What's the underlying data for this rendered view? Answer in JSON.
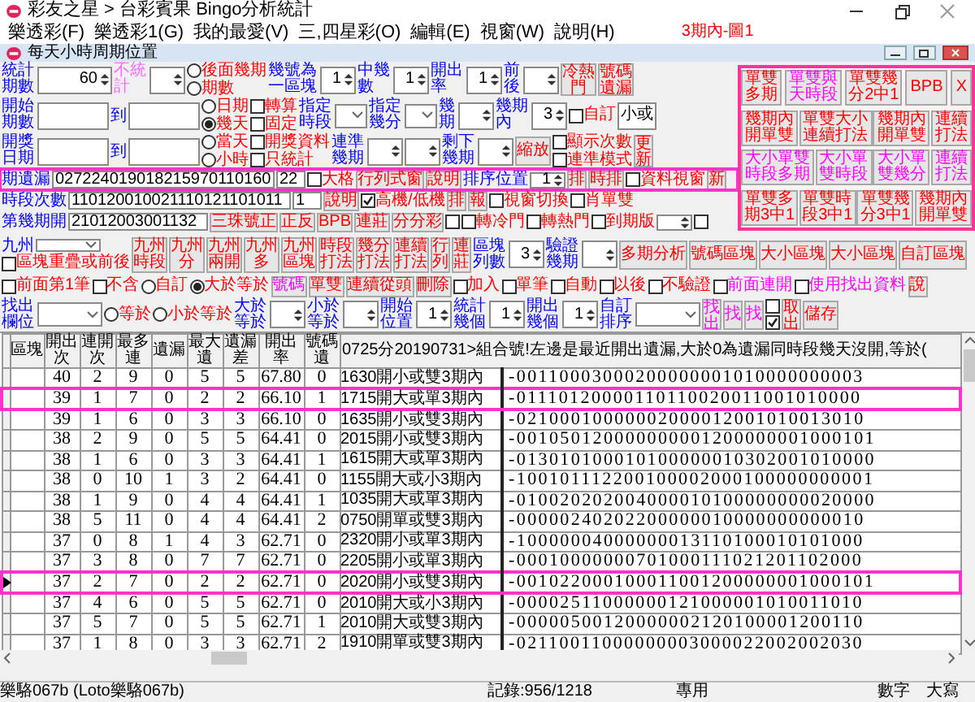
{
  "window": {
    "title": "彩友之星 > 台彩賓果 Bingo分析統計"
  },
  "menu": [
    "樂透彩(F)",
    "樂透彩1(G)",
    "我的最愛(V)",
    "三,四星彩(O)",
    "編輯(E)",
    "視窗(W)",
    "說明(H)"
  ],
  "caption": "3期內-圖1",
  "child_window": {
    "title": "每天小時周期位置"
  },
  "top_rows": [
    {
      "highlighted": false,
      "items": [
        {
          "kind": "label2",
          "text": "統計期數",
          "color": "#0000ff"
        },
        {
          "kind": "wide_spinner",
          "value": "60"
        },
        {
          "kind": "label2",
          "text": "不統計",
          "color": "#ff66ff"
        },
        {
          "kind": "spinner"
        },
        {
          "kind": "stack",
          "rows": [
            [
              {
                "kind": "radio",
                "text": "後面幾期",
                "color": "#ff0000",
                "selected": false
              }
            ],
            [
              {
                "kind": "radio",
                "text": "期數",
                "color": "#ff0000",
                "selected": false
              }
            ]
          ]
        },
        {
          "kind": "label2",
          "text": "幾號為一區塊",
          "color": "#0000ff"
        },
        {
          "kind": "spinner",
          "value": "1"
        },
        {
          "kind": "label2",
          "text": "中幾數",
          "color": "#0000ff"
        },
        {
          "kind": "spinner",
          "value": "1"
        },
        {
          "kind": "label2",
          "text": "開出率",
          "color": "#0000ff"
        },
        {
          "kind": "spinner",
          "value": "1"
        },
        {
          "kind": "label2",
          "text": "前後",
          "color": "#0000ff"
        },
        {
          "kind": "spinner"
        },
        {
          "kind": "button2",
          "text": "冷熱門",
          "color": "#ff0000"
        },
        {
          "kind": "button2",
          "text": "號碼遺漏",
          "color": "#ff0000"
        }
      ]
    },
    {
      "highlighted": false,
      "items": [
        {
          "kind": "label2",
          "text": "開始期數",
          "color": "#0000ff"
        },
        {
          "kind": "wide_field"
        },
        {
          "kind": "label",
          "text": "到",
          "color": "#0000ff"
        },
        {
          "kind": "wide_field"
        },
        {
          "kind": "stack",
          "rows": [
            [
              {
                "kind": "radio",
                "text": "日期",
                "color": "#ff0000",
                "selected": false
              },
              {
                "kind": "checkbox",
                "text": "轉算",
                "color": "#ff0000",
                "checked": false
              }
            ],
            [
              {
                "kind": "radio",
                "text": "幾天",
                "color": "#ff0000",
                "selected": true
              },
              {
                "kind": "checkbox",
                "text": "固定",
                "color": "#ff0000",
                "checked": false
              }
            ]
          ]
        },
        {
          "kind": "label2",
          "text": "指定時段",
          "color": "#0000ff"
        },
        {
          "kind": "dropdown"
        },
        {
          "kind": "label2",
          "text": "指定幾分",
          "color": "#0000ff"
        },
        {
          "kind": "dropdown"
        },
        {
          "kind": "label2",
          "text": "幾期",
          "color": "#0000ff"
        },
        {
          "kind": "spinner"
        },
        {
          "kind": "label2",
          "text": "幾期內",
          "color": "#0000ff"
        },
        {
          "kind": "spinner",
          "value": "3"
        },
        {
          "kind": "checkbox",
          "text": "自訂",
          "color": "#ff0000",
          "checked": false
        },
        {
          "kind": "field",
          "value": "小或"
        }
      ]
    },
    {
      "highlighted": false,
      "items": [
        {
          "kind": "label2",
          "text": "開獎日期",
          "color": "#0000ff"
        },
        {
          "kind": "wide_field"
        },
        {
          "kind": "label",
          "text": "到",
          "color": "#0000ff"
        },
        {
          "kind": "wide_field"
        },
        {
          "kind": "stack",
          "rows": [
            [
              {
                "kind": "radio",
                "text": "當天",
                "color": "#ff0000",
                "selected": false
              },
              {
                "kind": "checkbox",
                "text": "開獎資料",
                "color": "#ff0000",
                "checked": false
              }
            ],
            [
              {
                "kind": "radio",
                "text": "小時",
                "color": "#ff0000",
                "selected": false
              },
              {
                "kind": "checkbox",
                "text": "只統計",
                "color": "#ff0000",
                "checked": false
              }
            ]
          ]
        },
        {
          "kind": "label2",
          "text": "連準幾期",
          "color": "#0000ff"
        },
        {
          "kind": "spinner"
        },
        {
          "kind": "spinner"
        },
        {
          "kind": "label2",
          "text": "剩下幾期",
          "color": "#0000ff"
        },
        {
          "kind": "spinner"
        },
        {
          "kind": "button",
          "text": "縮放",
          "color": "#ff0000"
        },
        {
          "kind": "stack",
          "rows": [
            [
              {
                "kind": "checkbox",
                "text": "顯示次數",
                "color": "#ff0000",
                "checked": false
              }
            ],
            [
              {
                "kind": "checkbox",
                "text": "連準模式",
                "color": "#ff0000",
                "checked": false
              }
            ]
          ]
        },
        {
          "kind": "button2",
          "text": "更新",
          "color": "#ff0000"
        }
      ]
    },
    {
      "highlighted": true,
      "items": [
        {
          "kind": "label",
          "text": "期遺漏",
          "color": "#0000ff"
        },
        {
          "kind": "long_field",
          "value": "027224019018215970110160"
        },
        {
          "kind": "short_field",
          "value": "22"
        },
        {
          "kind": "checkbox",
          "text": "大格",
          "color": "#ff0000",
          "checked": false
        },
        {
          "kind": "button",
          "text": "行列式窗",
          "color": "#ff0000"
        },
        {
          "kind": "button",
          "text": "說明",
          "color": "#ff0000"
        },
        {
          "kind": "label",
          "text": "排序位置",
          "color": "#0000ff"
        },
        {
          "kind": "spinner",
          "value": "1"
        },
        {
          "kind": "button",
          "text": "排",
          "color": "#ff0000"
        },
        {
          "kind": "button",
          "text": "時排",
          "color": "#ff0000"
        },
        {
          "kind": "checkbox",
          "text": "資料視窗",
          "color": "#ff0000",
          "checked": false
        },
        {
          "kind": "button",
          "text": "新",
          "color": "#ff0000"
        }
      ]
    },
    {
      "highlighted": false,
      "items": [
        {
          "kind": "label",
          "text": "時段次數",
          "color": "#0000ff"
        },
        {
          "kind": "long_field",
          "value": "110120010021110121101011"
        },
        {
          "kind": "short_field",
          "value": "1"
        },
        {
          "kind": "button",
          "text": "說明",
          "color": "#ff0000"
        },
        {
          "kind": "checkbox",
          "text": "高機/低機",
          "color": "#ff0000",
          "checked": true
        },
        {
          "kind": "button",
          "text": "排",
          "color": "#ff0000"
        },
        {
          "kind": "button",
          "text": "報",
          "color": "#ff0000"
        },
        {
          "kind": "checkbox",
          "text": "視窗切換",
          "color": "#ff0000",
          "checked": false
        },
        {
          "kind": "checkbox",
          "text": "肖單雙",
          "color": "#ff0000",
          "checked": false
        }
      ]
    },
    {
      "highlighted": false,
      "items": [
        {
          "kind": "label",
          "text": "第幾期開",
          "color": "#0000ff"
        },
        {
          "kind": "mid_field",
          "value": "21012003001132"
        },
        {
          "kind": "button",
          "text": "三珠號正",
          "color": "#ff0000"
        },
        {
          "kind": "button",
          "text": "正反",
          "color": "#ff0000"
        },
        {
          "kind": "button",
          "text": "BPB",
          "color": "#ff0000"
        },
        {
          "kind": "button",
          "text": "連莊",
          "color": "#ff0000"
        },
        {
          "kind": "button",
          "text": "分分彩",
          "color": "#ff0000"
        },
        {
          "kind": "checkbox",
          "checked": false
        },
        {
          "kind": "checkbox",
          "text": "轉冷門",
          "color": "#ff0000",
          "checked": false
        },
        {
          "kind": "checkbox",
          "text": "轉熱門",
          "color": "#ff0000",
          "checked": false
        },
        {
          "kind": "checkbox",
          "text": "到期版",
          "color": "#ff0000",
          "checked": false
        },
        {
          "kind": "spinner"
        },
        {
          "kind": "checkbox",
          "checked": false
        }
      ]
    }
  ],
  "panel": [
    [
      {
        "text": "單雙多期",
        "color": "#ff0000"
      },
      {
        "text": "單雙與天時段",
        "color": "#ff00ff"
      },
      {
        "text": "單雙幾分2中1",
        "color": "#ff0000"
      },
      {
        "text": "BPB",
        "color": "#ff0000"
      },
      {
        "text": "X",
        "color": "#ff0000"
      }
    ],
    [
      {
        "text": "幾期內開單雙",
        "color": "#ff0000"
      },
      {
        "text": "單雙大小連續打法",
        "color": "#ff0000"
      },
      {
        "text": "幾期內開單雙",
        "color": "#ff0000"
      },
      {
        "text": "連續打法",
        "color": "#ff0000"
      }
    ],
    [
      {
        "text": "大小單雙時段多期",
        "color": "#ff00ff"
      },
      {
        "text": "大小單雙時段",
        "color": "#ff00ff"
      },
      {
        "text": "大小單雙幾分",
        "color": "#ff00ff"
      },
      {
        "text": "連續打法",
        "color": "#ff00ff"
      }
    ],
    [
      {
        "text": "單雙多期3中1",
        "color": "#ff0000"
      },
      {
        "text": "單雙時段3中1",
        "color": "#ff0000"
      },
      {
        "text": "單雙幾分3中1",
        "color": "#ff0000"
      },
      {
        "text": "幾期內開單雙",
        "color": "#ff0000"
      }
    ]
  ],
  "bottom_rows": [
    {
      "highlighted": false,
      "items": [
        {
          "kind": "stack",
          "rows": [
            [
              {
                "kind": "label",
                "text": "九州",
                "color": "#0000ff"
              },
              {
                "kind": "dropdown_wide"
              }
            ],
            [
              {
                "kind": "checkbox",
                "text": "區塊重疊或前後",
                "color": "#ff0000",
                "checked": false
              }
            ]
          ]
        },
        {
          "kind": "button2",
          "text": "九州時段",
          "color": "#ff0000"
        },
        {
          "kind": "button2",
          "text": "九州分",
          "color": "#ff0000"
        },
        {
          "kind": "button2",
          "text": "九州兩開",
          "color": "#ff0000"
        },
        {
          "kind": "button2",
          "text": "九州多",
          "color": "#ff0000"
        },
        {
          "kind": "button2",
          "text": "九州區塊",
          "color": "#ff0000"
        },
        {
          "kind": "button2",
          "text": "時段打法",
          "color": "#ff0000"
        },
        {
          "kind": "button2",
          "text": "幾分打法",
          "color": "#ff0000"
        },
        {
          "kind": "button2",
          "text": "連續打法",
          "color": "#ff0000"
        },
        {
          "kind": "button2",
          "text": "行列",
          "color": "#ff0000"
        },
        {
          "kind": "button2",
          "text": "連莊",
          "color": "#ff0000"
        },
        {
          "kind": "label2",
          "text": "區塊列數",
          "color": "#0000ff"
        },
        {
          "kind": "spinner",
          "value": "3"
        },
        {
          "kind": "label2",
          "text": "驗證幾期",
          "color": "#0000ff"
        },
        {
          "kind": "spinner"
        },
        {
          "kind": "button",
          "text": "多期分析",
          "color": "#ff0000"
        },
        {
          "kind": "button",
          "text": "號碼區塊",
          "color": "#ff0000"
        },
        {
          "kind": "button",
          "text": "大小區塊",
          "color": "#ff0000"
        },
        {
          "kind": "button",
          "text": "大小區塊",
          "color": "#ff0000"
        },
        {
          "kind": "button",
          "text": "自訂區塊",
          "color": "#ff0000"
        }
      ]
    },
    {
      "highlighted": false,
      "items": [
        {
          "kind": "checkbox",
          "text": "前面第1筆",
          "color": "#ff0000",
          "checked": false
        },
        {
          "kind": "checkbox",
          "text": "不含",
          "color": "#ff0000",
          "checked": false
        },
        {
          "kind": "radio",
          "text": "自訂",
          "color": "#ff0000",
          "selected": false
        },
        {
          "kind": "radio",
          "text": "大於等於",
          "color": "#ff0000",
          "selected": true
        },
        {
          "kind": "button",
          "text": "號碼",
          "color": "#ff00ff"
        },
        {
          "kind": "button",
          "text": "單雙",
          "color": "#ff0000"
        },
        {
          "kind": "button",
          "text": "連續從頭",
          "color": "#ff0000"
        },
        {
          "kind": "button",
          "text": "刪除",
          "color": "#ff0000"
        },
        {
          "kind": "checkbox",
          "text": "加入",
          "color": "#ff0000",
          "checked": false
        },
        {
          "kind": "checkbox",
          "text": "單筆",
          "color": "#ff0000",
          "checked": false
        },
        {
          "kind": "checkbox",
          "text": "自動",
          "color": "#ff0000",
          "checked": false
        },
        {
          "kind": "checkbox",
          "text": "以後",
          "color": "#ff0000",
          "checked": false
        },
        {
          "kind": "checkbox",
          "text": "不驗證",
          "color": "#ff0000",
          "checked": false
        },
        {
          "kind": "checkbox",
          "text": "前面連開",
          "color": "#ff00ff",
          "checked": false
        },
        {
          "kind": "checkbox",
          "text": "使用找出資料",
          "color": "#ff00ff",
          "checked": false
        },
        {
          "kind": "button",
          "text": "說",
          "color": "#ff0000"
        }
      ]
    },
    {
      "highlighted": false,
      "items": [
        {
          "kind": "label2",
          "text": "找出欄位",
          "color": "#0000ff"
        },
        {
          "kind": "dropdown_wide"
        },
        {
          "kind": "radio",
          "text": "等於",
          "color": "#ff0000",
          "selected": false
        },
        {
          "kind": "radio",
          "text": "小於等於",
          "color": "#ff0000",
          "selected": false
        },
        {
          "kind": "label2",
          "text": "大於等於",
          "color": "#0000ff"
        },
        {
          "kind": "spinner"
        },
        {
          "kind": "label2",
          "text": "小於等於",
          "color": "#0000ff"
        },
        {
          "kind": "spinner"
        },
        {
          "kind": "label2",
          "text": "開始位置",
          "color": "#0000ff"
        },
        {
          "kind": "spinner",
          "value": "1"
        },
        {
          "kind": "label2",
          "text": "統計幾個",
          "color": "#0000ff"
        },
        {
          "kind": "spinner",
          "value": "1"
        },
        {
          "kind": "label2",
          "text": "開出幾個",
          "color": "#0000ff"
        },
        {
          "kind": "spinner",
          "value": "1"
        },
        {
          "kind": "label2",
          "text": "自訂排序",
          "color": "#0000ff"
        },
        {
          "kind": "dropdown_wide"
        },
        {
          "kind": "button2",
          "text": "找出",
          "color": "#ff00ff"
        },
        {
          "kind": "button",
          "text": "找",
          "color": "#ff00ff"
        },
        {
          "kind": "button",
          "text": "找",
          "color": "#ff00ff"
        },
        {
          "kind": "stack",
          "rows": [
            [
              {
                "kind": "checkbox",
                "checked": false
              }
            ],
            [
              {
                "kind": "checkbox",
                "checked": true
              }
            ]
          ]
        },
        {
          "kind": "button2",
          "text": "取出",
          "color": "#ff0000"
        },
        {
          "kind": "button",
          "text": "儲存",
          "color": "#ff0000"
        }
      ]
    }
  ],
  "table": {
    "columns": [
      {
        "text": "區塊"
      },
      {
        "text": "開出次"
      },
      {
        "text": "連開次"
      },
      {
        "text": "最多連"
      },
      {
        "text": "遺漏"
      },
      {
        "text": "最大遺"
      },
      {
        "text": "遺漏差"
      },
      {
        "text": "開出率"
      },
      {
        "text": "號碼遺"
      },
      {
        "text": "0725分20190731>組合號!左邊是最近開出遺漏,大於0為遺漏同時段幾天沒開,等於(",
        "colspan": 2
      }
    ],
    "rows": [
      {
        "selected": false,
        "current": false,
        "cells": [
          "",
          "40",
          "2",
          "9",
          "0",
          "5",
          "5",
          "67.80",
          "0",
          "1630開小或雙3期內",
          "-00110003000200000001010000000003"
        ]
      },
      {
        "selected": true,
        "current": false,
        "cells": [
          "",
          "39",
          "1",
          "7",
          "0",
          "2",
          "2",
          "66.10",
          "1",
          "1715開大或單3期內",
          "-01110120000110110020011001010000"
        ]
      },
      {
        "selected": false,
        "current": false,
        "cells": [
          "",
          "39",
          "1",
          "6",
          "0",
          "3",
          "3",
          "66.10",
          "0",
          "1635開小或雙3期內",
          "-02100010000002000012001010013010"
        ]
      },
      {
        "selected": false,
        "current": false,
        "cells": [
          "",
          "38",
          "2",
          "9",
          "0",
          "5",
          "5",
          "64.41",
          "0",
          "2015開小或雙3期內",
          "-001050120000000001200000001000101"
        ]
      },
      {
        "selected": false,
        "current": false,
        "cells": [
          "",
          "38",
          "1",
          "6",
          "0",
          "3",
          "3",
          "64.41",
          "1",
          "1615開大或單3期內",
          "-013010100010100000010302001010000"
        ]
      },
      {
        "selected": false,
        "current": false,
        "cells": [
          "",
          "38",
          "0",
          "10",
          "1",
          "3",
          "2",
          "64.41",
          "0",
          "1155開大或小3期內",
          "-100101112200100002000100000000001"
        ]
      },
      {
        "selected": false,
        "current": false,
        "cells": [
          "",
          "38",
          "1",
          "9",
          "0",
          "4",
          "4",
          "64.41",
          "1",
          "1035開大或單3期內",
          "-010020202004000010100000000020000"
        ]
      },
      {
        "selected": false,
        "current": false,
        "cells": [
          "",
          "38",
          "5",
          "11",
          "0",
          "4",
          "4",
          "64.41",
          "2",
          "0750開單或雙3期內",
          "-00000240202200000010000000000010"
        ]
      },
      {
        "selected": false,
        "current": false,
        "cells": [
          "",
          "37",
          "0",
          "8",
          "1",
          "4",
          "3",
          "62.71",
          "0",
          "2320開小或單3期內",
          "-10000004000000013110100010101000"
        ]
      },
      {
        "selected": false,
        "current": false,
        "cells": [
          "",
          "37",
          "3",
          "8",
          "0",
          "7",
          "7",
          "62.71",
          "0",
          "2205開小或單3期內",
          "-00010000000701000111021201102000"
        ]
      },
      {
        "selected": true,
        "current": true,
        "cells": [
          "",
          "37",
          "2",
          "7",
          "0",
          "2",
          "2",
          "62.71",
          "0",
          "2020開小或雙3期內",
          "-001022000100011001200000001000101"
        ]
      },
      {
        "selected": false,
        "current": false,
        "cells": [
          "",
          "37",
          "4",
          "6",
          "0",
          "5",
          "5",
          "62.71",
          "0",
          "2010開大或小3期內",
          "-00002511000000121000001010011010"
        ]
      },
      {
        "selected": false,
        "current": false,
        "cells": [
          "",
          "37",
          "5",
          "7",
          "0",
          "5",
          "5",
          "62.71",
          "1",
          "2010開大或雙3期內",
          "-00000500120000002120100001200110"
        ]
      },
      {
        "selected": false,
        "current": false,
        "cells": [
          "",
          "37",
          "1",
          "8",
          "0",
          "3",
          "3",
          "62.71",
          "2",
          "1910開單或雙3期內",
          "-02110011000000003000022002002030"
        ]
      }
    ]
  },
  "status_bar": [
    "樂駱067b (Loto樂駱067b)",
    "記錄:956/1218",
    "專用",
    "數字",
    "大寫"
  ]
}
